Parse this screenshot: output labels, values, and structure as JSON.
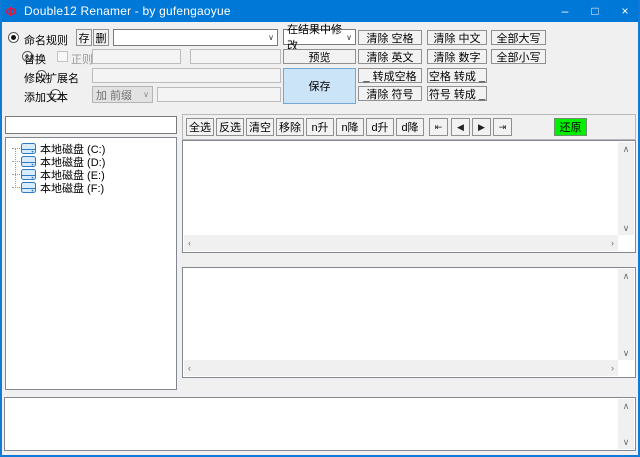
{
  "titlebar": {
    "icon_glyph": "Φ",
    "title": "Double12 Renamer - by gufengaoyue",
    "minimize": "–",
    "maximize": "□",
    "close": "×"
  },
  "rules": {
    "rule_name": {
      "label": "命名规则",
      "save": "存",
      "delete": "删",
      "combo_value": ""
    },
    "replace": {
      "label": "替换",
      "regex": "正则",
      "find": "",
      "repl": ""
    },
    "extension": {
      "label": "修改扩展名",
      "value": ""
    },
    "add_text": {
      "label": "添加文本",
      "mode": "加 前缀",
      "value": ""
    }
  },
  "actions": {
    "scope": "在结果中修改",
    "preview": "预览",
    "save": "保存",
    "group1": [
      "清除 空格",
      "清除 英文",
      "_ 转成空格",
      "清除 符号"
    ],
    "group2": [
      "清除 中文",
      "清除 数字",
      "空格 转成 _",
      "符号 转成 _"
    ],
    "group3": [
      "全部大写",
      "全部小写"
    ]
  },
  "toolbar": {
    "buttons": [
      "全选",
      "反选",
      "清空",
      "移除",
      "n升",
      "n降",
      "d升",
      "d降"
    ],
    "nav": [
      "⇤",
      "◀",
      "▶",
      "⇥"
    ],
    "restore": "还原"
  },
  "sidebar": {
    "filter_value": "",
    "tree": [
      "本地磁盘 (C:)",
      "本地磁盘 (D:)",
      "本地磁盘 (E:)",
      "本地磁盘 (F:)"
    ]
  },
  "icons": {
    "chevron": "∨",
    "scroll_up": "∧",
    "scroll_down": "∨",
    "scroll_left": "‹",
    "scroll_right": "›"
  },
  "colors": {
    "titlebar": "#0078d7",
    "save_bg": "#cce4f7",
    "restore_bg": "#00f000"
  }
}
